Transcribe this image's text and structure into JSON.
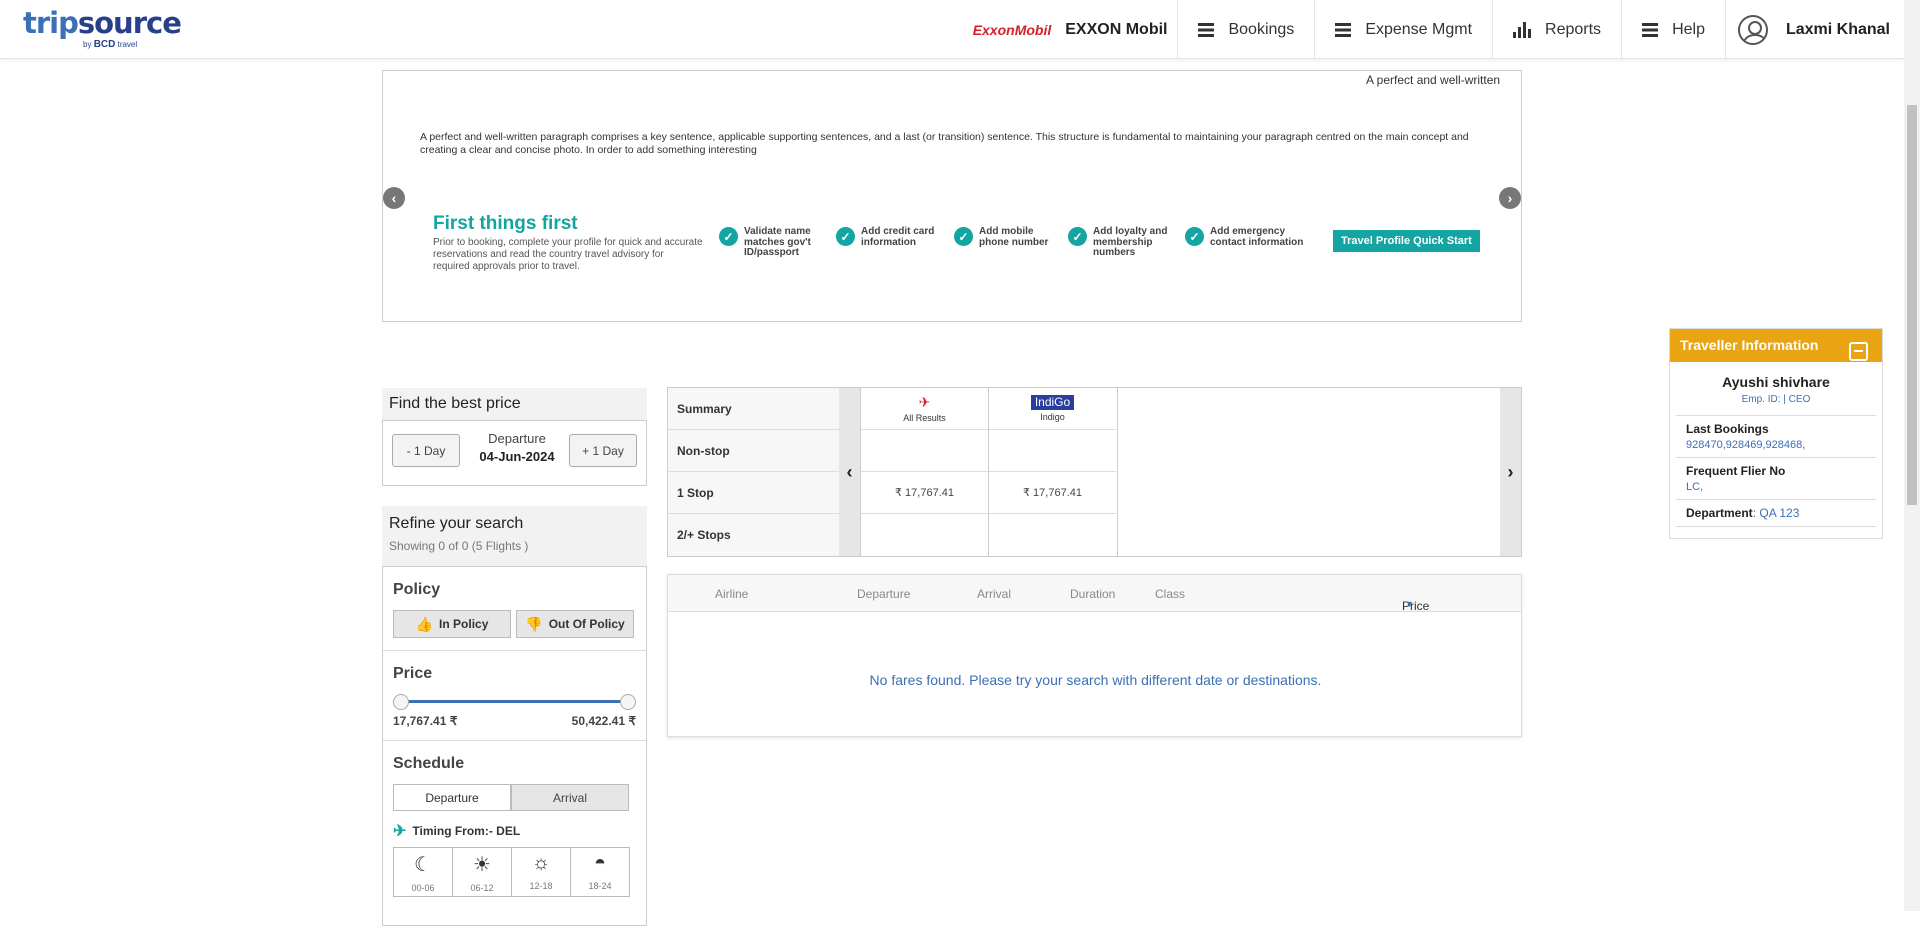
{
  "header": {
    "logo_main_a": "trip",
    "logo_main_b": "source",
    "logo_sub_by": "by",
    "logo_sub_brand": "BCD",
    "logo_sub_travel": "travel",
    "company_logo_text": "ExxonMobil",
    "company_name": "EXXON Mobil",
    "nav": {
      "bookings": "Bookings",
      "expense": "Expense Mgmt",
      "reports": "Reports",
      "help": "Help"
    },
    "user_name": "Laxmi Khanal"
  },
  "banner": {
    "marquee_text": "A perfect and well-written",
    "paragraph": "A perfect and well-written paragraph comprises a key sentence, applicable supporting sentences, and a last (or transition) sentence. This structure is fundamental to maintaining your paragraph centred on the main concept and creating a clear and concise photo. In order to add something interesting",
    "ftf_title": "First things first",
    "ftf_subtitle": "Prior to booking, complete your profile for quick and accurate reservations and read the country travel advisory for required approvals prior to travel.",
    "checks": [
      "Validate name matches gov't ID/passport",
      "Add credit card information",
      "Add mobile phone number",
      "Add loyalty and membership numbers",
      "Add emergency contact information"
    ],
    "quick_start": "Travel Profile Quick Start"
  },
  "find_best_price": {
    "title": "Find the best price",
    "minus_day": "- 1 Day",
    "plus_day": "+ 1 Day",
    "departure_label": "Departure",
    "departure_date": "04-Jun-2024"
  },
  "refine": {
    "title": "Refine your search",
    "showing": "Showing 0 of 0 (5 Flights )",
    "policy_title": "Policy",
    "in_policy": "In Policy",
    "out_policy": "Out Of Policy",
    "price_title": "Price",
    "price_min": "17,767.41 ₹",
    "price_max": "50,422.41 ₹",
    "schedule_title": "Schedule",
    "tab_departure": "Departure",
    "tab_arrival": "Arrival",
    "timing_from": "Timing From:- DEL",
    "time_slots": [
      "00-06",
      "06-12",
      "12-18",
      "18-24"
    ]
  },
  "summary": {
    "rows": [
      "Summary",
      "Non-stop",
      "1 Stop",
      "2/+ Stops"
    ],
    "col1_airline": "All Results",
    "col2_logo": "IndiGo",
    "col2_airline": "Indigo",
    "col1_one_stop": "₹ 17,767.41",
    "col2_one_stop": "₹ 17,767.41"
  },
  "results": {
    "columns": {
      "airline": "Airline",
      "departure": "Departure",
      "arrival": "Arrival",
      "duration": "Duration",
      "class": "Class",
      "price": "Price"
    },
    "empty_message": "No fares found. Please try your search with different date or destinations."
  },
  "traveller": {
    "title": "Traveller Information",
    "name": "Ayushi shivhare",
    "emp": "Emp. ID: | CEO",
    "last_bookings_label": "Last Bookings",
    "last_bookings": "928470,928469,928468,",
    "ffn_label": "Frequent Flier No",
    "ffn": "LC,",
    "dept_label": "Department",
    "dept": ": QA 123"
  },
  "colors": {
    "brand_blue": "#3b6fb6",
    "teal": "#14a5a2",
    "amber": "#e8a413",
    "exxon_red": "#d6202a"
  },
  "price_slider": {
    "low_fraction": 0.0,
    "high_fraction": 1.0
  }
}
